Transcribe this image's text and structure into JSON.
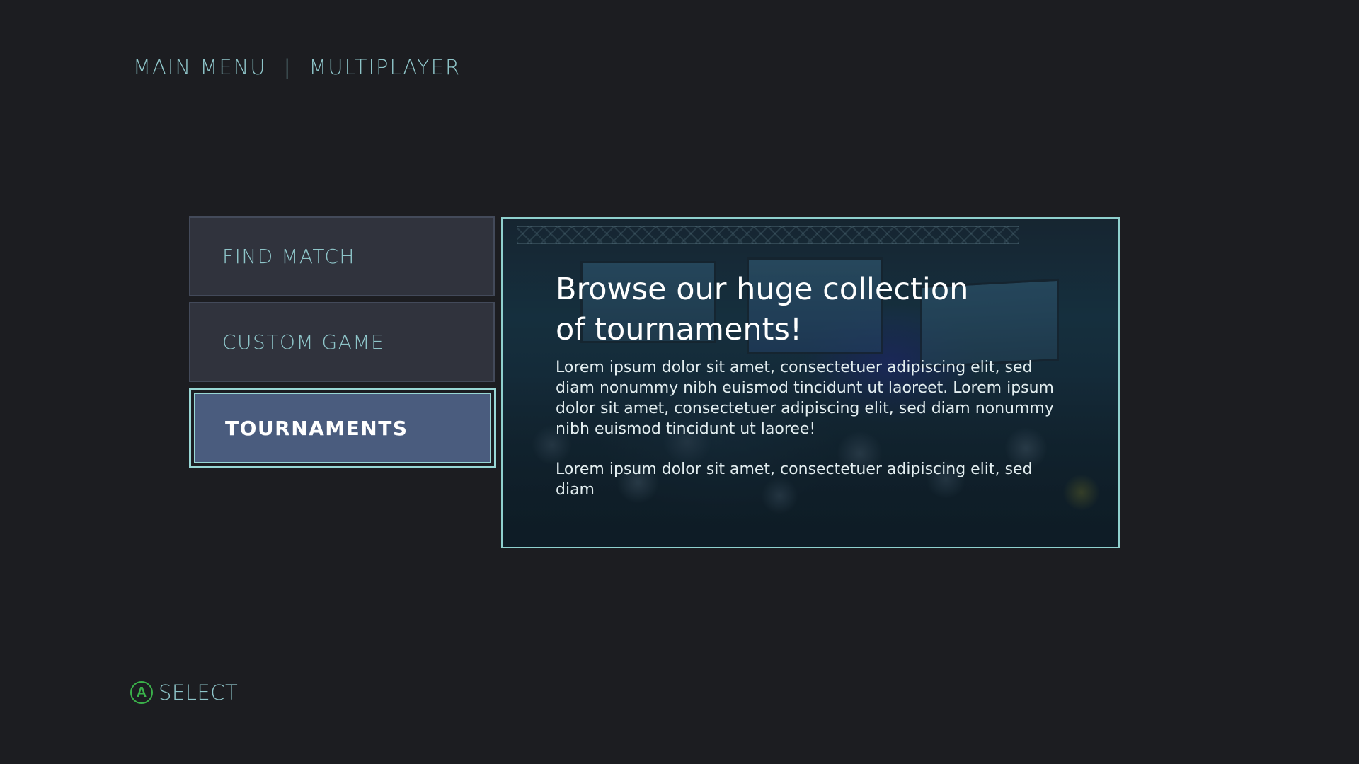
{
  "breadcrumb": {
    "root": "MAIN MENU",
    "separator": "|",
    "current": "MULTIPLAYER"
  },
  "menu": {
    "items": [
      {
        "label": "FIND MATCH",
        "selected": false
      },
      {
        "label": "CUSTOM GAME",
        "selected": false
      },
      {
        "label": "TOURNAMENTS",
        "selected": true
      }
    ]
  },
  "panel": {
    "title": "Browse our huge collection of tournaments!",
    "paragraphs": [
      "Lorem ipsum dolor sit amet, consectetuer adipiscing elit, sed diam nonummy nibh euismod tincidunt ut laoreet. Lorem ipsum dolor sit amet, consectetuer adipiscing elit, sed diam nonummy nibh euismod tincidunt ut laoree!",
      "Lorem ipsum dolor sit amet, consectetuer adipiscing elit, sed diam"
    ],
    "image_icon": "tournament-arena-image"
  },
  "footer": {
    "button_glyph": "A",
    "button_icon": "a-button-icon",
    "label": "SELECT"
  },
  "colors": {
    "background": "#1c1d21",
    "accent": "#8ec5c9",
    "selected_fill": "#4a5c7e",
    "selected_border": "#98d7d5",
    "a_button": "#3ab14a"
  }
}
